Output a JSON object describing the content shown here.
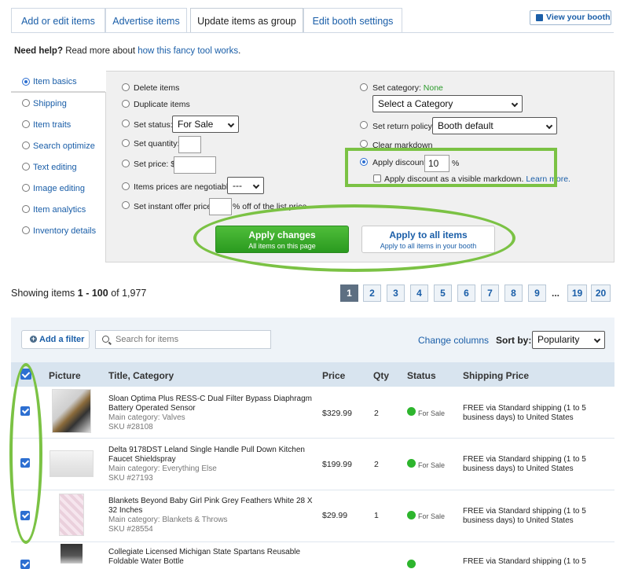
{
  "tabs": [
    {
      "label": "Add or edit items",
      "active": false
    },
    {
      "label": "Advertise items",
      "active": false
    },
    {
      "label": "Update items as group",
      "active": true
    },
    {
      "label": "Edit booth settings",
      "active": false
    }
  ],
  "view_booth": "View your booth",
  "help": {
    "prefix": "Need help?",
    "middle": "Read more about",
    "link": "how this fancy tool works",
    "suffix": "."
  },
  "left_nav": [
    "Item basics",
    "Shipping",
    "Item traits",
    "Search optimize",
    "Text editing",
    "Image editing",
    "Item analytics",
    "Inventory details"
  ],
  "options_left": {
    "delete": "Delete items",
    "duplicate": "Duplicate items",
    "set_status": "Set status:",
    "status_value": "For Sale",
    "set_quantity": "Set quantity:",
    "set_price": "Set price: $",
    "negotiable": "Items prices are negotiable:",
    "negotiable_value": "---",
    "instant_offer": "Set instant offer price:",
    "instant_offer_suffix": "% off of the list price"
  },
  "options_right": {
    "set_category": "Set category:",
    "category_current": "None",
    "category_select": "Select a Category",
    "return_policy": "Set return policy:",
    "return_value": "Booth default",
    "clear_markdown": "Clear markdown",
    "apply_discount": "Apply discount:",
    "discount_value": "10",
    "percent": "%",
    "visible_markdown": "Apply discount as a visible markdown.",
    "learn_more": "Learn more."
  },
  "apply_changes": {
    "title": "Apply changes",
    "sub": "All items on this page"
  },
  "apply_all": {
    "title": "Apply to all items",
    "sub": "Apply to all items in your booth"
  },
  "showing": {
    "prefix": "Showing items",
    "range": "1 - 100",
    "of": "of 1,977"
  },
  "pages": [
    "1",
    "2",
    "3",
    "4",
    "5",
    "6",
    "7",
    "8",
    "9",
    "19",
    "20"
  ],
  "ellipsis": "...",
  "toolbar": {
    "add_filter": "Add a filter",
    "search_placeholder": "Search for items",
    "change_columns": "Change columns",
    "sort_by": "Sort by:",
    "sort_value": "Popularity"
  },
  "columns": [
    "Picture",
    "Title, Category",
    "Price",
    "Qty",
    "Status",
    "Shipping Price"
  ],
  "rows": [
    {
      "title1": "Sloan Optima Plus RESS-C Dual Filter Bypass Diaphragm",
      "title2": "Battery Operated Sensor",
      "category": "Main category: Valves",
      "sku": "SKU #28108",
      "price": "$329.99",
      "qty": "2",
      "status": "For Sale",
      "ship1": "FREE via Standard shipping (1 to 5",
      "ship2": "business days) to United States"
    },
    {
      "title1": "Delta 9178DST Leland Single Handle Pull Down Kitchen",
      "title2": "Faucet Shieldspray",
      "category": "Main category: Everything Else",
      "sku": "SKU #27193",
      "price": "$199.99",
      "qty": "2",
      "status": "For Sale",
      "ship1": "FREE via Standard shipping (1 to 5",
      "ship2": "business days) to United States"
    },
    {
      "title1": "Blankets Beyond Baby Girl Pink Grey Feathers White 28 X",
      "title2": "32 Inches",
      "category": "Main category: Blankets & Throws",
      "sku": "SKU #28554",
      "price": "$29.99",
      "qty": "1",
      "status": "For Sale",
      "ship1": "FREE via Standard shipping (1 to 5",
      "ship2": "business days) to United States"
    },
    {
      "title1": "Collegiate Licensed Michigan State Spartans Reusable",
      "title2": "Foldable Water Bottle",
      "ship1": "FREE via Standard shipping (1 to 5"
    }
  ],
  "colors": {
    "link": "#1a5ea8",
    "green_button": "#2a9a1f",
    "highlight": "#7bc244",
    "status_green": "#2db52d"
  }
}
